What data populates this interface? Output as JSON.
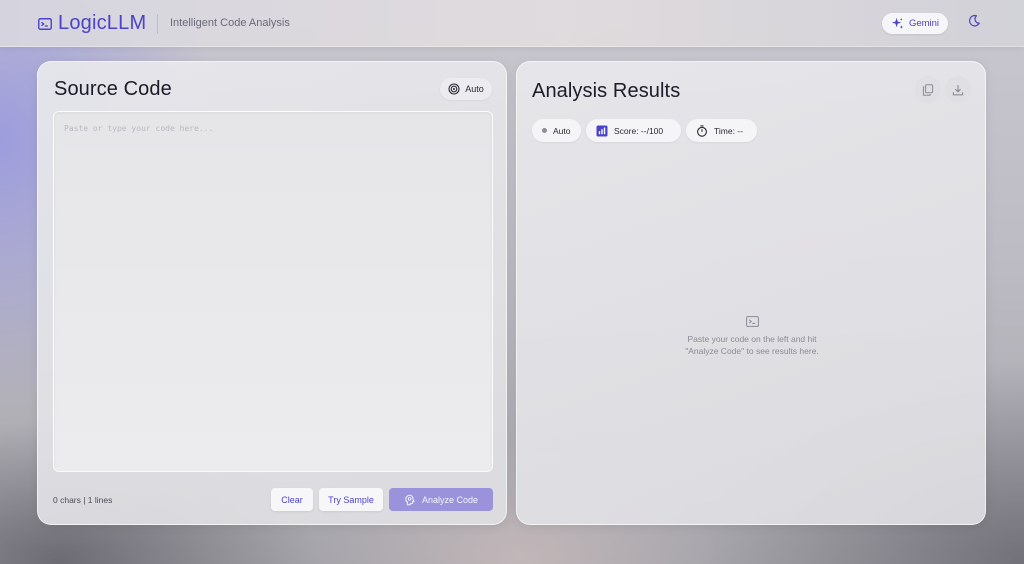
{
  "header": {
    "brand_icon": "terminal-icon",
    "brand_name": "LogicLLM",
    "tagline": "Intelligent Code Analysis",
    "model_label": "Gemini",
    "model_icon": "sparkle-icon",
    "theme_icon": "moon-icon",
    "accent_color": "#4b43c9"
  },
  "source_panel": {
    "title": "Source Code",
    "language_label": "Auto",
    "language_icon": "target-icon",
    "code_value": "",
    "placeholder": "Paste or type your code here...",
    "stats": "0 chars | 1 lines",
    "clear_label": "Clear",
    "sample_label": "Try Sample",
    "analyze_label": "Analyze Code",
    "analyze_icon": "brain-icon"
  },
  "results_panel": {
    "title": "Analysis Results",
    "copy_icon": "copy-icon",
    "download_icon": "download-icon",
    "chips": {
      "language": "Auto",
      "score": "Score: --/100",
      "time": "Time: --"
    },
    "empty_icon": "terminal-icon",
    "empty_line1": "Paste your code on the left and hit",
    "empty_line2": "\"Analyze Code\" to see results here."
  }
}
